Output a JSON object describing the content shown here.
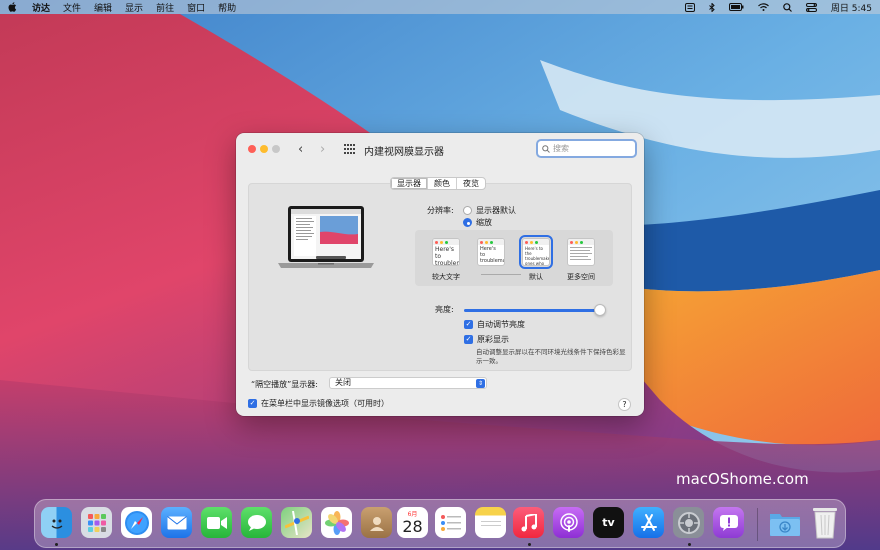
{
  "menubar": {
    "app_name": "访达",
    "items": [
      "文件",
      "编辑",
      "显示",
      "前往",
      "窗口",
      "帮助"
    ],
    "clock": "周日 5:45"
  },
  "window": {
    "title": "内建视网膜显示器",
    "search_placeholder": "搜索",
    "tabs": [
      "显示器",
      "颜色",
      "夜览"
    ],
    "resolution_label": "分辨率:",
    "resolution_options": [
      "显示器默认",
      "缩放"
    ],
    "resolution_selected": "缩放",
    "scale_options": [
      {
        "label": "较大文字",
        "preview": "Here's to troublem"
      },
      {
        "label": "",
        "preview": "Here's to troublema ones who"
      },
      {
        "label": "默认",
        "preview": "Here's to the troublemakers ones who see"
      },
      {
        "label": "更多空间",
        "preview": ""
      }
    ],
    "brightness_label": "亮度:",
    "brightness_level": 0.97,
    "auto_brightness_label": "自动调节亮度",
    "true_tone_label": "原彩显示",
    "true_tone_desc": "自动调整显示屏以在不同环境光线条件下保持色彩显示一致。",
    "airplay_label": "“隔空播放”显示器:",
    "airplay_value": "关闭",
    "mirror_label": "在菜单栏中显示镜像选项（可用时）",
    "help_label": "?"
  },
  "watermark": "macOShome.com",
  "dock": {
    "calendar_month": "6月",
    "calendar_day": "28",
    "tv_label": "tv",
    "apps": [
      "finder-icon",
      "launchpad-icon",
      "safari-icon",
      "mail-icon",
      "facetime-icon",
      "messages-icon",
      "maps-icon",
      "photos-icon",
      "contacts-icon",
      "calendar-icon",
      "reminders-icon",
      "notes-icon",
      "music-icon",
      "podcasts-icon",
      "tv-icon",
      "app-store-icon",
      "system-preferences-icon",
      "feedback-icon",
      "downloads-folder-icon",
      "trash-icon"
    ]
  },
  "colors": {
    "accent": "#2f6fe4",
    "close": "#fe5f57",
    "minimize": "#febc2e"
  }
}
